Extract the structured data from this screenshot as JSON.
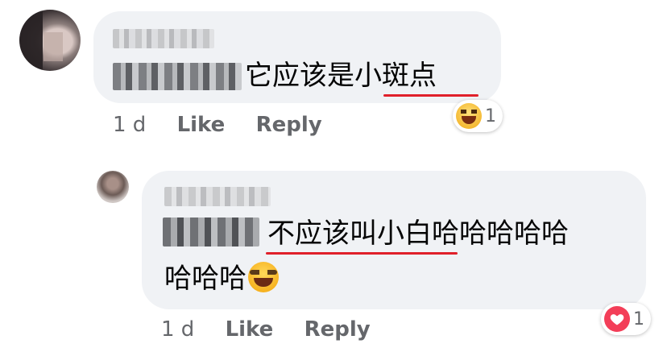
{
  "comment1": {
    "text": "它应该是小斑点",
    "time": "1 d",
    "like_label": "Like",
    "reply_label": "Reply",
    "reaction": {
      "icon": "haha-emoji-icon",
      "count": "1"
    }
  },
  "comment2": {
    "text_line1": "不应该叫小白哈哈哈哈哈",
    "text_line2": "哈哈哈",
    "emoji": "tears-of-joy-emoji-icon",
    "time": "1 d",
    "like_label": "Like",
    "reply_label": "Reply",
    "reaction": {
      "icon": "love-heart-icon",
      "count": "1"
    }
  },
  "colors": {
    "underline": "#e0202a",
    "bubble": "#f0f2f5",
    "meta": "#65676b",
    "love": "#f33e58"
  }
}
